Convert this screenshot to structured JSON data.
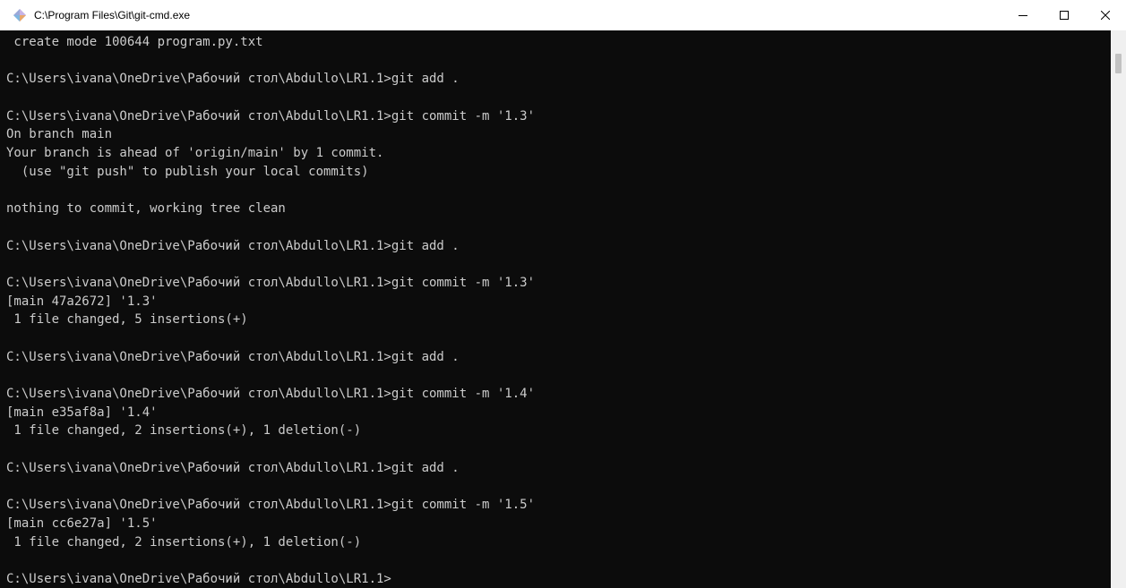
{
  "window": {
    "title": "C:\\Program Files\\Git\\git-cmd.exe",
    "icon": "git-icon",
    "controls": {
      "minimize": "minimize-icon",
      "maximize": "maximize-icon",
      "close": "close-icon"
    }
  },
  "console": {
    "lines": [
      " create mode 100644 program.py.txt",
      "",
      "C:\\Users\\ivana\\OneDrive\\Рабочий стол\\Abdullo\\LR1.1>git add .",
      "",
      "C:\\Users\\ivana\\OneDrive\\Рабочий стол\\Abdullo\\LR1.1>git commit -m '1.3'",
      "On branch main",
      "Your branch is ahead of 'origin/main' by 1 commit.",
      "  (use \"git push\" to publish your local commits)",
      "",
      "nothing to commit, working tree clean",
      "",
      "C:\\Users\\ivana\\OneDrive\\Рабочий стол\\Abdullo\\LR1.1>git add .",
      "",
      "C:\\Users\\ivana\\OneDrive\\Рабочий стол\\Abdullo\\LR1.1>git commit -m '1.3'",
      "[main 47a2672] '1.3'",
      " 1 file changed, 5 insertions(+)",
      "",
      "C:\\Users\\ivana\\OneDrive\\Рабочий стол\\Abdullo\\LR1.1>git add .",
      "",
      "C:\\Users\\ivana\\OneDrive\\Рабочий стол\\Abdullo\\LR1.1>git commit -m '1.4'",
      "[main e35af8a] '1.4'",
      " 1 file changed, 2 insertions(+), 1 deletion(-)",
      "",
      "C:\\Users\\ivana\\OneDrive\\Рабочий стол\\Abdullo\\LR1.1>git add .",
      "",
      "C:\\Users\\ivana\\OneDrive\\Рабочий стол\\Abdullo\\LR1.1>git commit -m '1.5'",
      "[main cc6e27a] '1.5'",
      " 1 file changed, 2 insertions(+), 1 deletion(-)",
      "",
      "C:\\Users\\ivana\\OneDrive\\Рабочий стол\\Abdullo\\LR1.1>"
    ]
  },
  "colors": {
    "background": "#0c0c0c",
    "text": "#cccccc",
    "titlebar": "#ffffff"
  }
}
